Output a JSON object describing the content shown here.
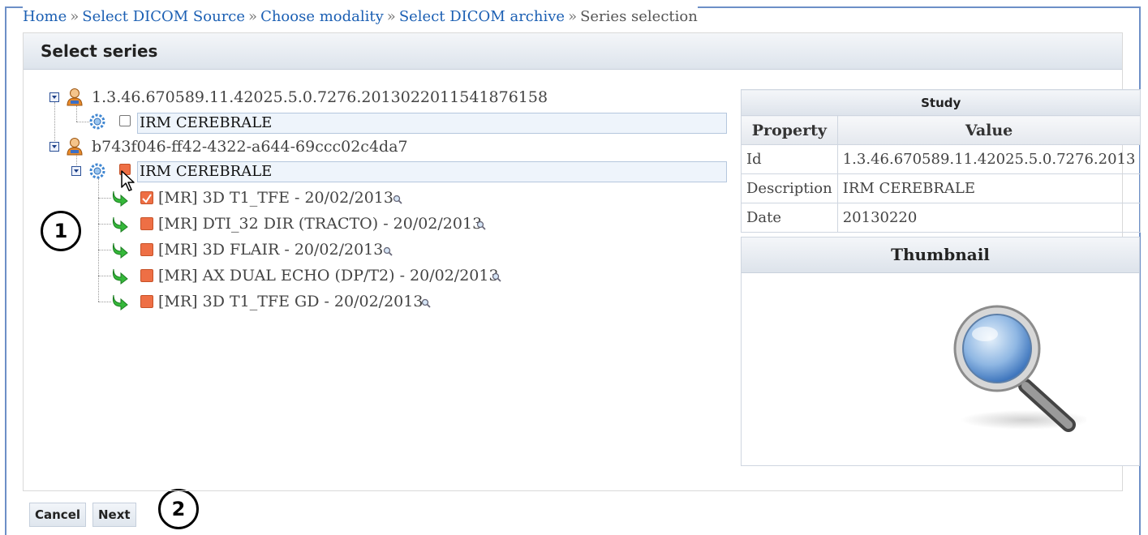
{
  "breadcrumb": {
    "items": [
      "Home",
      "Select DICOM Source",
      "Choose modality",
      "Select DICOM archive"
    ],
    "separator": "»",
    "current": "Series selection"
  },
  "panel": {
    "title": "Select series"
  },
  "tree": {
    "patients": [
      {
        "id": "1.3.46.670589.11.42025.5.0.7276.2013022011541876158",
        "study": {
          "label": "IRM CEREBRALE",
          "checked": false
        }
      },
      {
        "id": "b743f046-ff42-4322-a644-69ccc02c4da7",
        "study": {
          "label": "IRM CEREBRALE",
          "checked": true
        }
      }
    ],
    "series": [
      {
        "label": "[MR] 3D T1_TFE - 20/02/2013"
      },
      {
        "label": "[MR] DTI_32 DIR (TRACTO) - 20/02/2013"
      },
      {
        "label": "[MR] 3D FLAIR - 20/02/2013"
      },
      {
        "label": "[MR] AX DUAL ECHO (DP/T2) - 20/02/2013"
      },
      {
        "label": "[MR] 3D T1_TFE GD - 20/02/2013"
      }
    ]
  },
  "study_table": {
    "caption": "Study",
    "headers": {
      "property": "Property",
      "value": "Value"
    },
    "rows": [
      {
        "property": "Id",
        "value": "1.3.46.670589.11.42025.5.0.7276.2013"
      },
      {
        "property": "Description",
        "value": "IRM CEREBRALE"
      },
      {
        "property": "Date",
        "value": "20130220"
      }
    ]
  },
  "thumbnail": {
    "title": "Thumbnail"
  },
  "annotations": {
    "one": "1",
    "two": "2"
  },
  "buttons": {
    "cancel": "Cancel",
    "next": "Next"
  },
  "icons": {
    "expander": "collapse-icon",
    "patient": "person-icon",
    "study": "gear-icon",
    "series": "green-arrow-icon",
    "zoom": "magnifier-icon"
  },
  "colors": {
    "link": "#1b5fb3",
    "frame": "#6d8fc7",
    "checked": "#ee6f45",
    "arrow": "#35b83a"
  }
}
